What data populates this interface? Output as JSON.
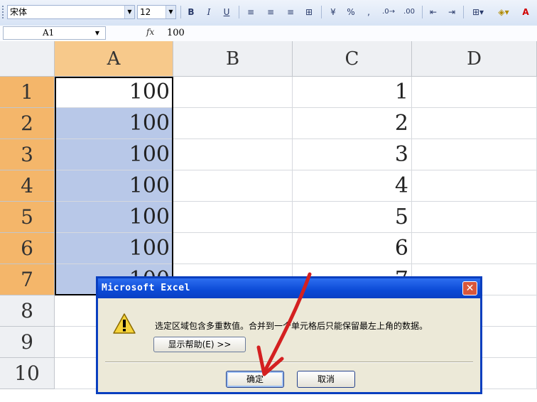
{
  "toolbar": {
    "font_name": "宋体",
    "font_size": "12",
    "bold": "B",
    "italic": "I",
    "underline": "U",
    "percent": "%"
  },
  "formula_bar": {
    "cell_ref": "A1",
    "fx": "fx",
    "value": "100"
  },
  "columns": [
    "A",
    "B",
    "C",
    "D"
  ],
  "rows": [
    "1",
    "2",
    "3",
    "4",
    "5",
    "6",
    "7",
    "8",
    "9",
    "10"
  ],
  "column_a": [
    "100",
    "100",
    "100",
    "100",
    "100",
    "100",
    "100"
  ],
  "column_c": [
    "1",
    "2",
    "3",
    "4",
    "5",
    "6",
    "7"
  ],
  "dialog": {
    "title": "Microsoft Excel",
    "message": "选定区域包含多重数值。合并到一个单元格后只能保留最左上角的数据。",
    "help_button": "显示帮助(E) >>",
    "ok_button": "确定",
    "cancel_button": "取消",
    "close_glyph": "✕"
  },
  "colors": {
    "selected_header": "#f4b66a",
    "selection_fill": "#b8c8e8",
    "dialog_title": "#0b4ad6",
    "annotation_arrow": "#d42020"
  }
}
